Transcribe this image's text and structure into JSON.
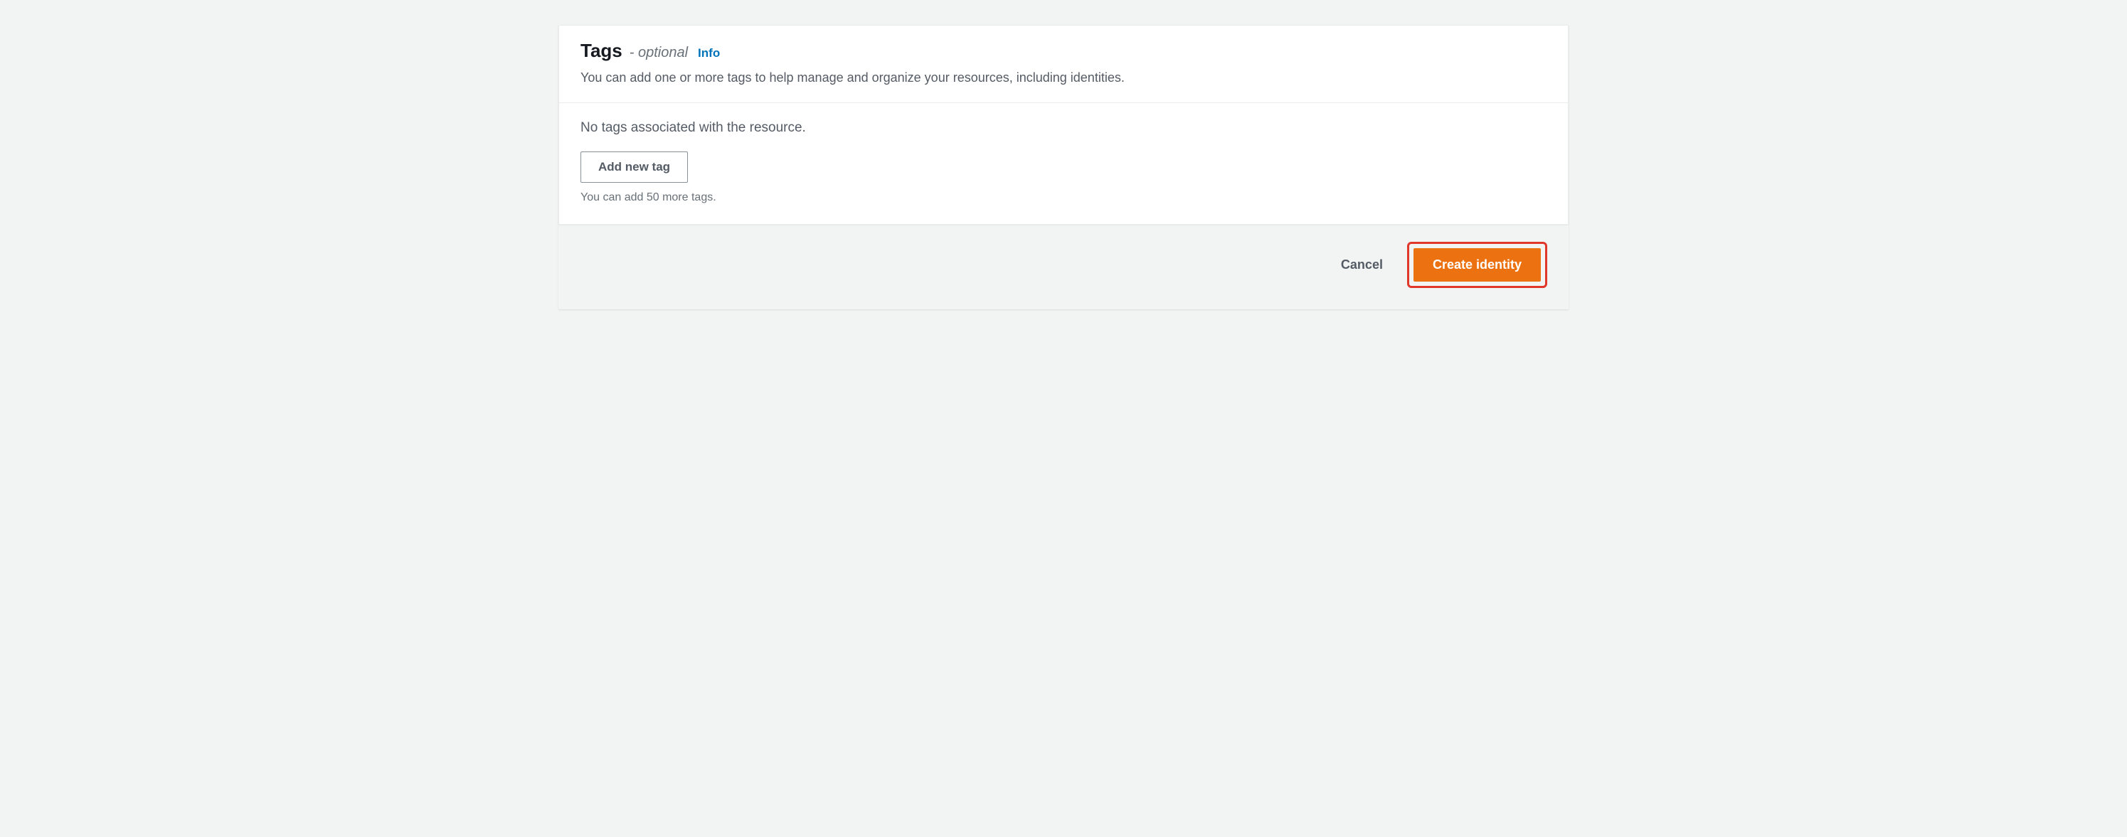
{
  "tags_panel": {
    "title": "Tags",
    "subtitle": "- optional",
    "info_link": "Info",
    "description": "You can add one or more tags to help manage and organize your resources, including identities.",
    "empty_message": "No tags associated with the resource.",
    "add_button": "Add new tag",
    "remaining_hint": "You can add 50 more tags."
  },
  "footer": {
    "cancel": "Cancel",
    "submit": "Create identity"
  }
}
